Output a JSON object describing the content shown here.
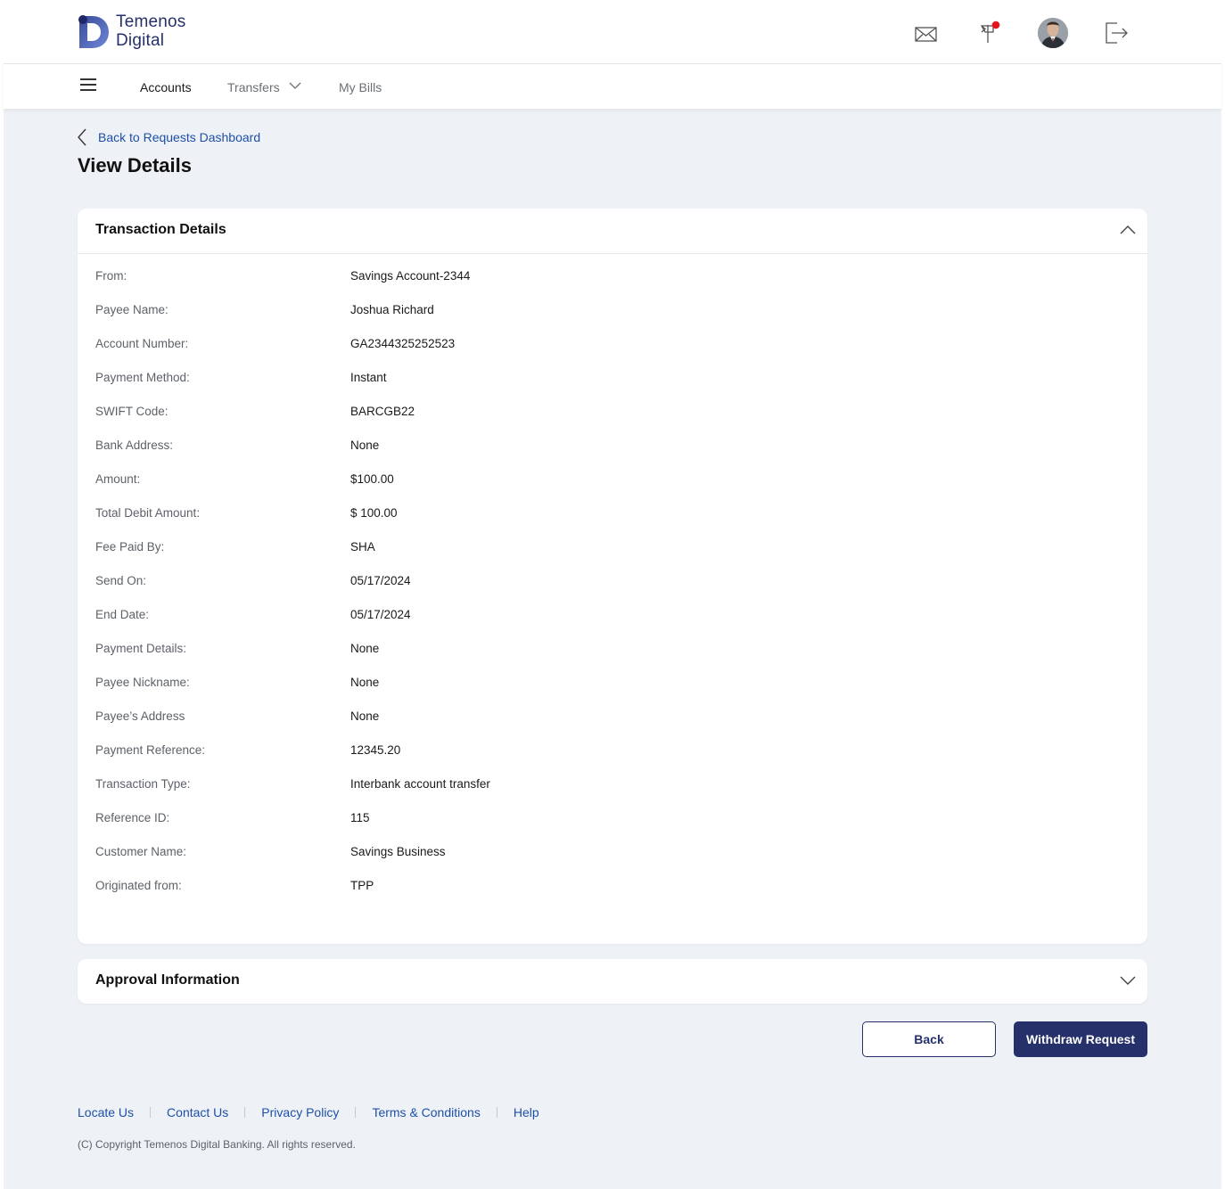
{
  "brand": {
    "line1": "Temenos",
    "line2": "Digital"
  },
  "header_icons": [
    "mail-icon",
    "flag-icon",
    "user-avatar",
    "logout-icon"
  ],
  "nav": {
    "accounts": "Accounts",
    "transfers": "Transfers",
    "my_bills": "My Bills"
  },
  "breadcrumb": {
    "back_label": "Back to Requests Dashboard"
  },
  "page": {
    "title": "View Details"
  },
  "transaction": {
    "title": "Transaction Details",
    "rows": [
      {
        "label": "From:",
        "value": "Savings Account-2344"
      },
      {
        "label": "Payee Name:",
        "value": "Joshua Richard"
      },
      {
        "label": "Account Number:",
        "value": "GA2344325252523"
      },
      {
        "label": "Payment Method:",
        "value": "Instant"
      },
      {
        "label": "SWIFT Code:",
        "value": "BARCGB22"
      },
      {
        "label": "Bank Address:",
        "value": "None"
      },
      {
        "label": "Amount:",
        "value": "$100.00"
      },
      {
        "label": "Total Debit Amount:",
        "value": "$ 100.00"
      },
      {
        "label": "Fee Paid By:",
        "value": "SHA"
      },
      {
        "label": "Send On:",
        "value": "05/17/2024"
      },
      {
        "label": "End Date:",
        "value": "05/17/2024"
      },
      {
        "label": "Payment Details:",
        "value": "None"
      },
      {
        "label": "Payee Nickname:",
        "value": "None"
      },
      {
        "label": "Payee’s Address",
        "value": "None"
      },
      {
        "label": "Payment Reference:",
        "value": "12345.20"
      },
      {
        "label": "Transaction Type:",
        "value": "Interbank account transfer"
      },
      {
        "label": "Reference ID:",
        "value": "115"
      },
      {
        "label": "Customer Name:",
        "value": "Savings Business"
      },
      {
        "label": "Originated from:",
        "value": "TPP"
      }
    ]
  },
  "approval": {
    "title": "Approval Information"
  },
  "actions": {
    "back": "Back",
    "withdraw": "Withdraw Request"
  },
  "footer": {
    "links": [
      "Locate Us",
      "Contact Us",
      "Privacy Policy",
      "Terms & Conditions",
      "Help"
    ],
    "copyright": "(C) Copyright Temenos Digital Banking. All rights reserved."
  },
  "colors": {
    "brand": "#26306b",
    "link": "#1e4fa8",
    "background": "#eef2f6",
    "notification": "#e8141b"
  }
}
